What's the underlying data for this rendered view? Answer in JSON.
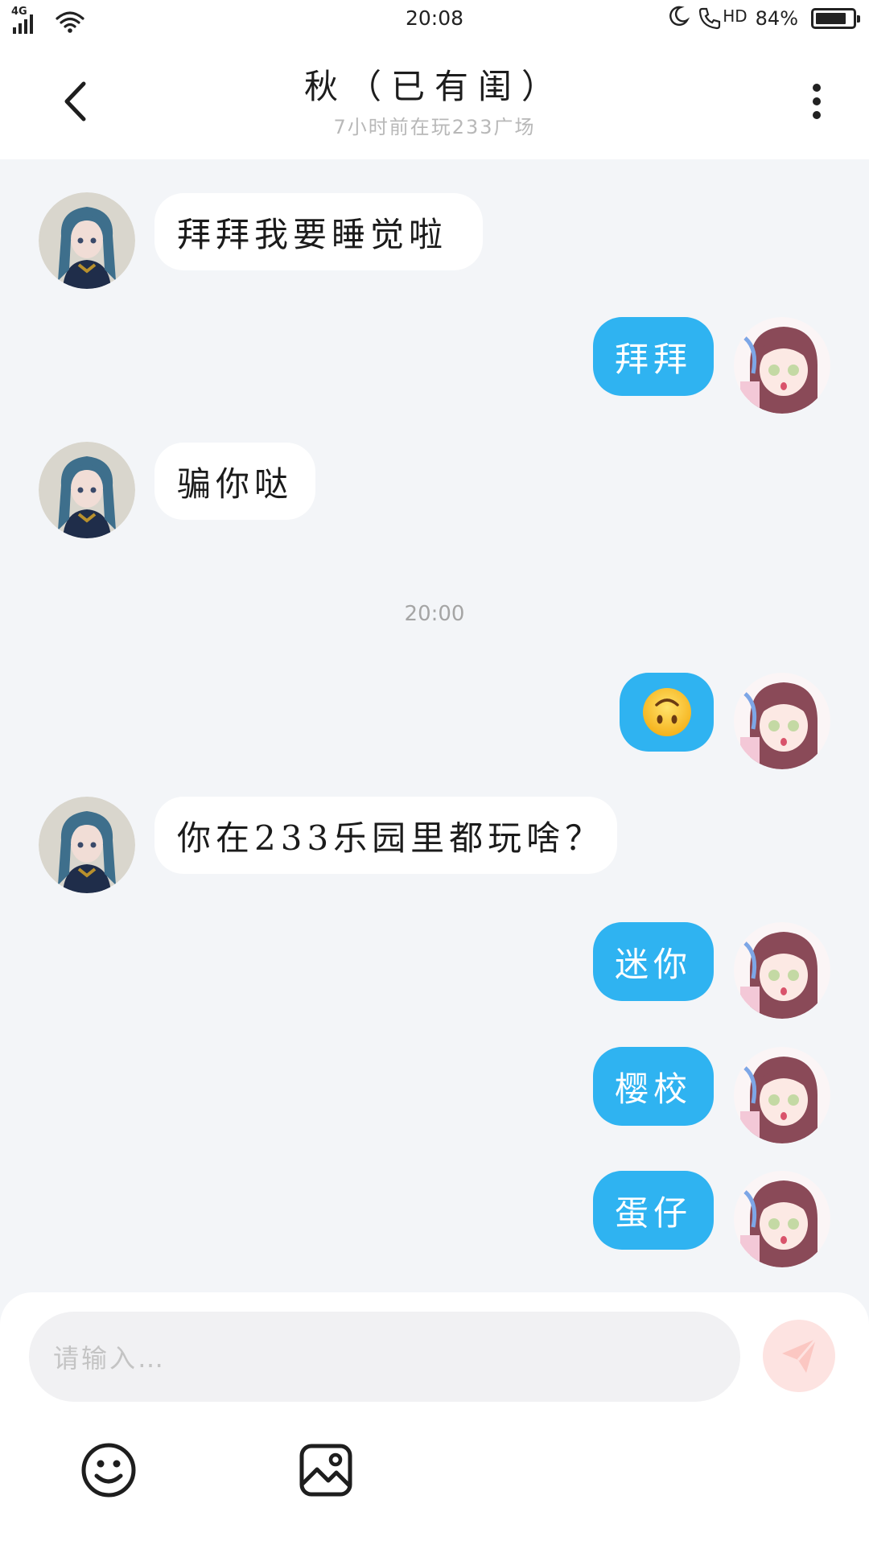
{
  "status_bar": {
    "network": "4G",
    "time": "20:08",
    "hd": "HD",
    "battery_text": "84%",
    "battery_level": 0.84
  },
  "header": {
    "back_icon": "chevron-left-icon",
    "title": "秋（已有闺）",
    "subtitle": "7小时前在玩233广场",
    "more_icon": "more-vertical-icon"
  },
  "messages": [
    {
      "side": "in",
      "text": "拜拜我要睡觉啦",
      "avatar": "teal-hair-girl-avatar"
    },
    {
      "side": "out",
      "text": "拜拜",
      "avatar": "pink-hair-girl-avatar"
    },
    {
      "side": "in",
      "text": "骗你哒",
      "avatar": "teal-hair-girl-avatar"
    },
    {
      "side": "time",
      "text": "20:00"
    },
    {
      "side": "out",
      "emoji": "upside-down-face-emoji",
      "avatar": "pink-hair-girl-avatar"
    },
    {
      "side": "in",
      "text": "你在233乐园里都玩啥？",
      "avatar": "teal-hair-girl-avatar"
    },
    {
      "side": "out",
      "text": "迷你",
      "avatar": "pink-hair-girl-avatar"
    },
    {
      "side": "out",
      "text": "樱校",
      "avatar": "pink-hair-girl-avatar"
    },
    {
      "side": "out",
      "text": "蛋仔",
      "avatar": "pink-hair-girl-avatar"
    }
  ],
  "composer": {
    "placeholder": "请输入…",
    "send_icon": "send-icon",
    "emoji_icon": "smiley-icon",
    "image_icon": "image-icon"
  },
  "colors": {
    "background": "#f3f5f8",
    "outgoing_bubble": "#2fb3f1",
    "incoming_bubble": "#ffffff",
    "send_button": "#fde3e1"
  }
}
